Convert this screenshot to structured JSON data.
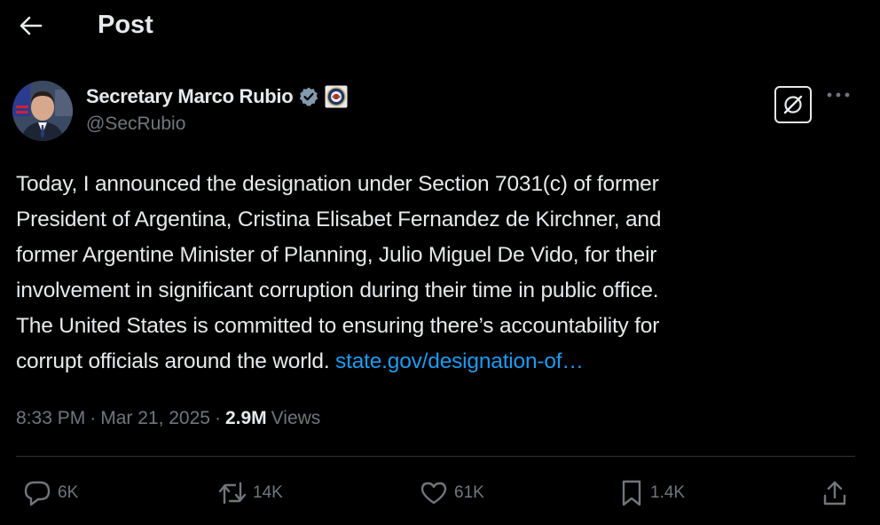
{
  "header": {
    "title": "Post"
  },
  "author": {
    "display_name": "Secretary Marco Rubio",
    "handle": "@SecRubio",
    "verified_icon": "verified-badge-icon",
    "affiliation_icon": "government-seal-icon"
  },
  "tweet": {
    "lines": [
      "Today, I announced the designation under Section 7031(c) of former",
      "President of Argentina, Cristina Elisabet Fernandez de Kirchner, and",
      "former Argentine Minister of Planning, Julio Miguel De Vido, for their",
      "involvement in significant corruption during their time in public office.",
      "The United States is committed to ensuring there’s accountability for",
      "corrupt officials around the world."
    ],
    "link": "state.gov/designation-of…"
  },
  "meta": {
    "time": "8:33 PM",
    "separator": "·",
    "date": "Mar 21, 2025",
    "views_count": "2.9M",
    "views_label": "Views"
  },
  "actions": {
    "replies": "6K",
    "reposts": "14K",
    "likes": "61K",
    "bookmarks": "1.4K"
  },
  "colors": {
    "background": "#000000",
    "text": "#e7e9ea",
    "muted": "#71767b",
    "link": "#1d9bf0",
    "verified": "#829aab",
    "divider": "#2f3336"
  }
}
